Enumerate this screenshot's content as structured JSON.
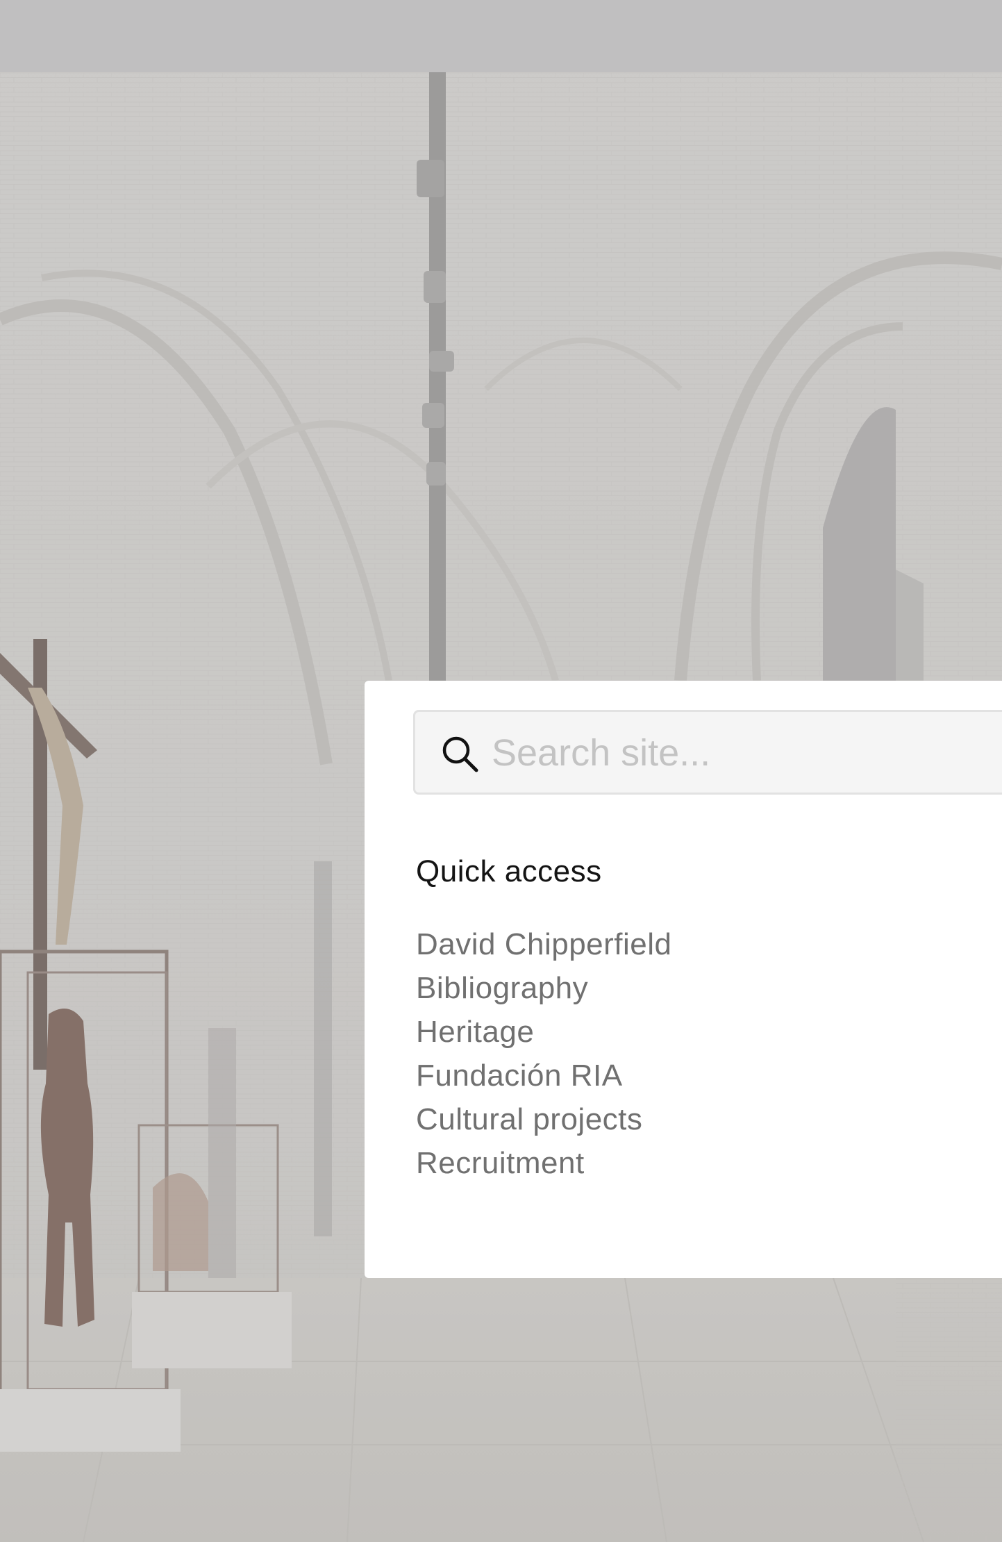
{
  "search": {
    "placeholder": "Search site...",
    "value": ""
  },
  "quick_access": {
    "title": "Quick access",
    "items": [
      {
        "label": "David Chipperfield"
      },
      {
        "label": "Bibliography"
      },
      {
        "label": "Heritage"
      },
      {
        "label": "Fundación RIA"
      },
      {
        "label": "Cultural projects"
      },
      {
        "label": "Recruitment"
      }
    ]
  },
  "colors": {
    "topbar": "#c0bfc0",
    "panel": "#ffffff",
    "search_field": "#f5f5f5",
    "link_text": "#707070",
    "heading_text": "#141414",
    "placeholder_text": "#c3c3c3"
  },
  "icons": {
    "search": "search-icon"
  }
}
